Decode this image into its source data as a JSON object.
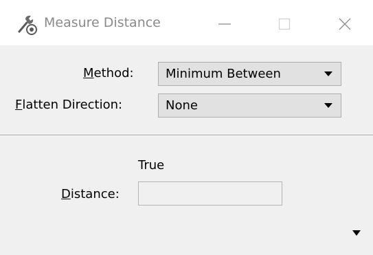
{
  "window": {
    "title": "Measure Distance",
    "icon": "measure-distance-app-icon"
  },
  "controls": {
    "minimize_icon": "minimize-icon",
    "maximize_icon": "maximize-icon",
    "close_icon": "close-icon"
  },
  "form": {
    "method": {
      "label_mnemonic": "M",
      "label_rest": "ethod:",
      "value": "Minimum Between"
    },
    "flatten_direction": {
      "label_mnemonic": "F",
      "label_rest": "latten Direction:",
      "value": "None"
    }
  },
  "results": {
    "column_header": "True",
    "distance": {
      "label_mnemonic": "D",
      "label_rest": "istance:",
      "value": ""
    }
  },
  "colors": {
    "title_text": "#8a8a8a",
    "dialog_bg": "#f0f0f0",
    "dropdown_bg": "#e1e1e1"
  }
}
